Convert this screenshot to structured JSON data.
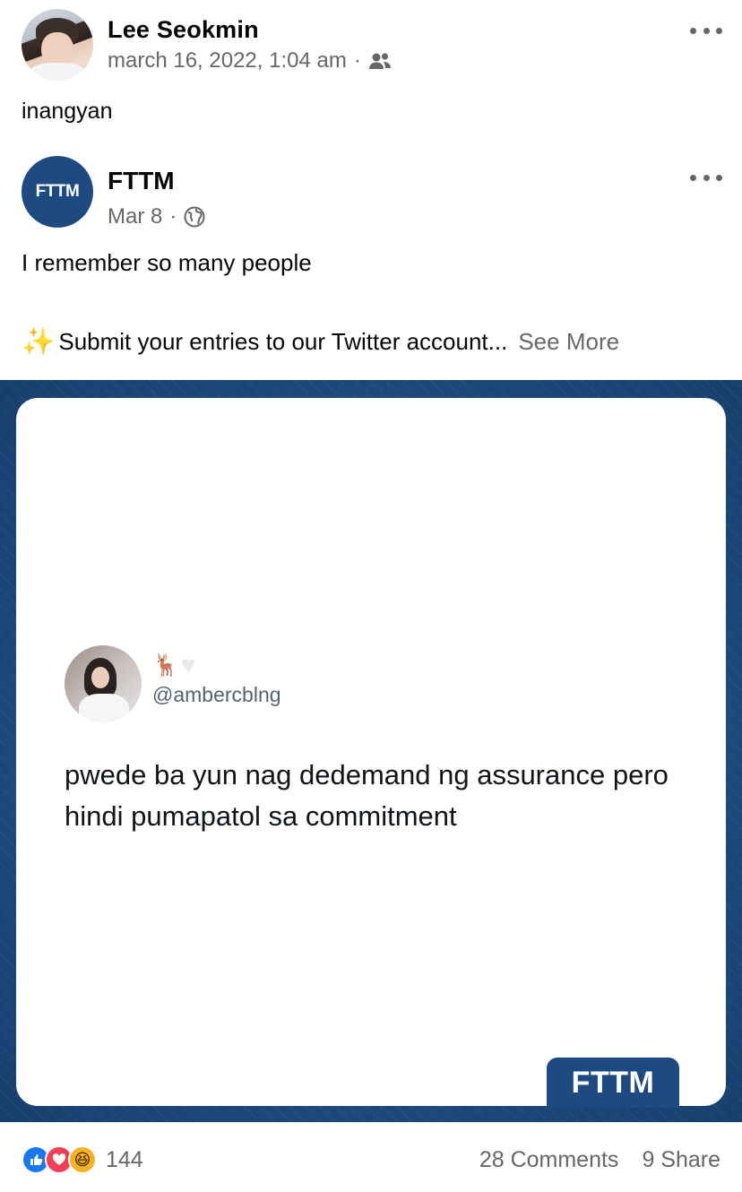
{
  "post": {
    "author": "Lee Seokmin",
    "timestamp": "march 16, 2022, 1:04 am",
    "audience_icon": "friends-icon",
    "text": "inangyan"
  },
  "shared_post": {
    "page_name": "FTTM",
    "logo_text": "FTTM",
    "date": "Mar 8",
    "audience_icon": "globe-icon",
    "line1": "I remember so many people",
    "line2": "Submit your entries to our Twitter account...",
    "see_more": "See More"
  },
  "media": {
    "tweet_handle": "@ambercblng",
    "tweet_emojis": [
      "deer",
      "white-heart"
    ],
    "tweet_text": "pwede ba yun nag dedemand ng assurance pero hindi pumapatol sa commitment",
    "brand_label": "FTTM",
    "colors": {
      "frame": "#1d4a80",
      "card": "#ffffff"
    }
  },
  "footer": {
    "reactions": [
      "like",
      "love",
      "haha"
    ],
    "reaction_count": "144",
    "comments": "28 Comments",
    "shares": "9 Share"
  }
}
